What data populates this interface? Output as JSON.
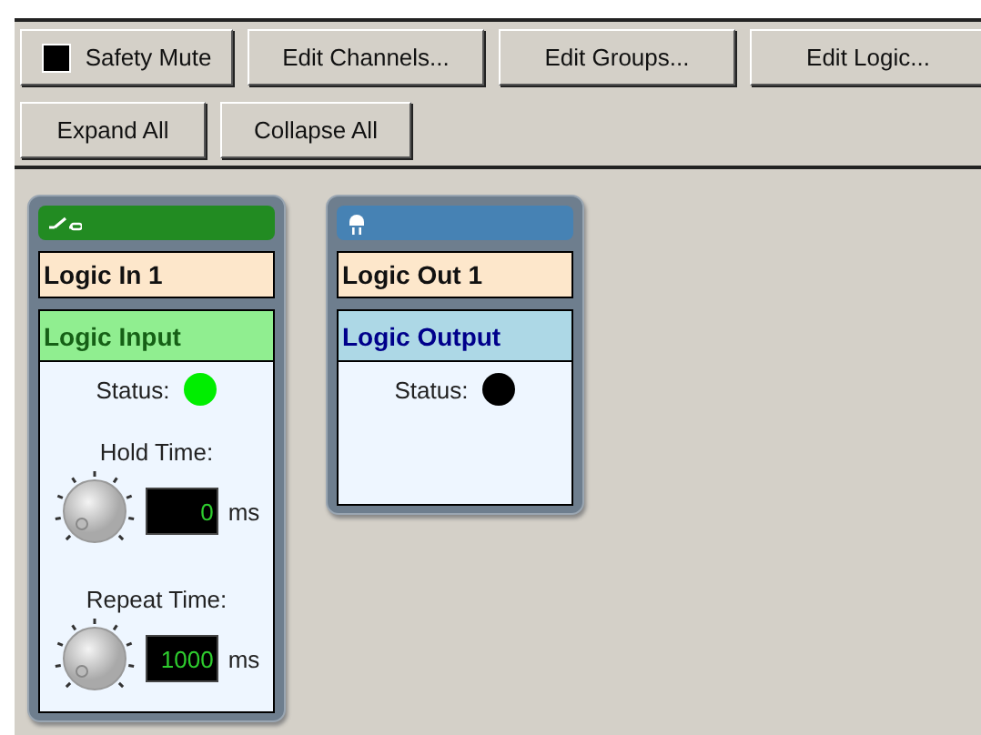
{
  "toolbar": {
    "rows": [
      [
        {
          "kind": "toggle",
          "label": "Safety Mute",
          "checked": true
        },
        {
          "kind": "button",
          "label": "Edit Channels..."
        },
        {
          "kind": "button",
          "label": "Edit Groups..."
        },
        {
          "kind": "button",
          "label": "Edit Logic..."
        }
      ],
      [
        {
          "kind": "button",
          "label": "Expand All"
        },
        {
          "kind": "button",
          "label": "Collapse All"
        }
      ]
    ]
  },
  "modules": [
    {
      "kind": "input",
      "name": "Logic In 1",
      "type": "Logic Input",
      "status_label": "Status:",
      "status_on": true,
      "controls": [
        {
          "label": "Hold Time:",
          "value": "0",
          "unit": "ms"
        },
        {
          "label": "Repeat Time:",
          "value": "1000",
          "unit": "ms"
        }
      ]
    },
    {
      "kind": "output",
      "name": "Logic Out 1",
      "type": "Logic Output",
      "status_label": "Status:",
      "status_on": false
    }
  ]
}
